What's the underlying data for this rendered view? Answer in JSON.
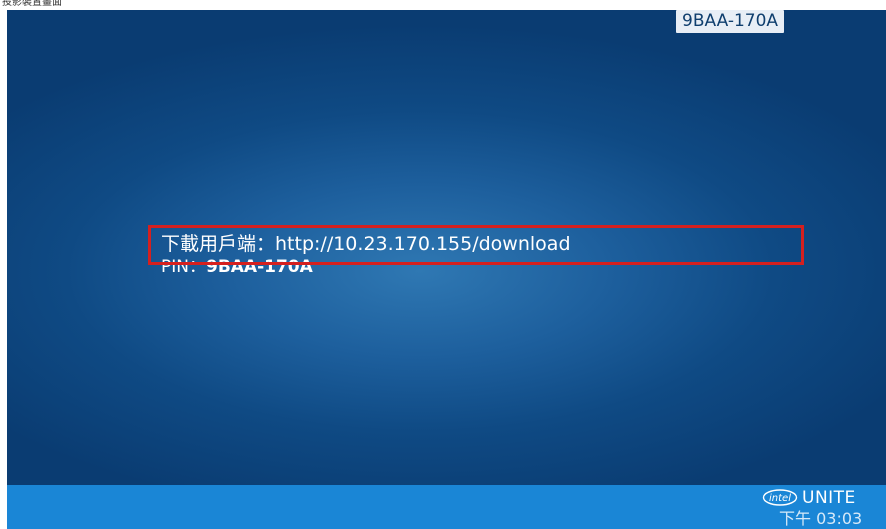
{
  "top_strip": {
    "label": "投影裝置畫面"
  },
  "screen": {
    "pin_badge": "9BAA-170A",
    "download": {
      "label": "下載用戶端：",
      "url": "http://10.23.170.155/download"
    },
    "pin": {
      "label": "PIN：",
      "value": "9BAA-170A"
    }
  },
  "bottom_bar": {
    "logo_text": "intel",
    "brand": "UNITE",
    "clock": "下午 03:03"
  },
  "colors": {
    "background_outer": "#0a3c72",
    "background_center": "#2f78b3",
    "bottom_bar": "#1a86d6",
    "highlight": "#d5201f",
    "badge": "#e8eef6"
  }
}
